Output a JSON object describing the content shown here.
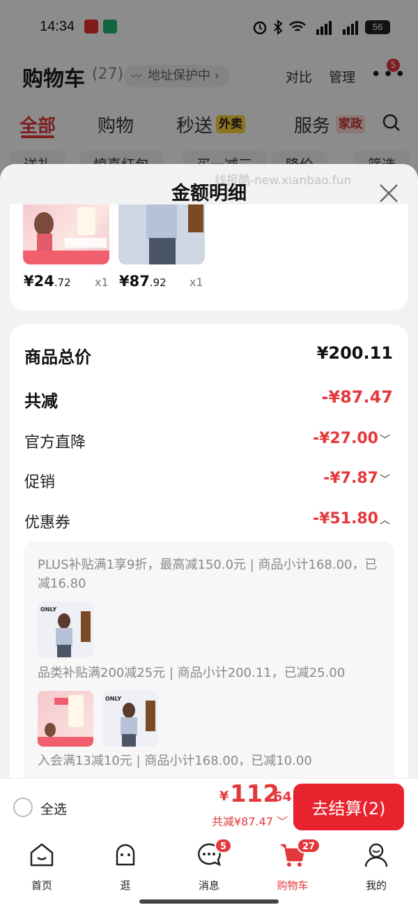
{
  "status_bar": {
    "time": "14:34",
    "battery": "56"
  },
  "header": {
    "title": "购物车",
    "count": "(27)",
    "address_protect": "地址保护中",
    "compare": "对比",
    "manage": "管理",
    "more_badge": "5"
  },
  "tabs": [
    {
      "label": "全部"
    },
    {
      "label": "购物"
    },
    {
      "label": "秒送",
      "pill": "外卖"
    },
    {
      "label": "服务",
      "pill": "家政"
    }
  ],
  "chips": [
    "送礼",
    "惊喜红包",
    "买一减三",
    "降价",
    "筛选"
  ],
  "sheet": {
    "title": "金额明细",
    "watermark": "线报酷-new.xianbao.fun",
    "products": [
      {
        "price_int": "¥24",
        "price_dec": ".72",
        "qty": "x1"
      },
      {
        "price_int": "¥87",
        "price_dec": ".92",
        "qty": "x1"
      }
    ],
    "rows": {
      "total": {
        "label": "商品总价",
        "value": "¥200.11"
      },
      "discount": {
        "label": "共减",
        "value": "-¥87.47"
      },
      "official": {
        "label": "官方直降",
        "value": "-¥27.00"
      },
      "promo": {
        "label": "促销",
        "value": "-¥7.87"
      },
      "coupon": {
        "label": "优惠券",
        "value": "-¥51.80"
      }
    },
    "coupons": [
      "PLUS补贴满1享9折，最高减150.0元 | 商品小计168.00，已减16.80",
      "品类补贴满200减25元 | 商品小计200.11，已减25.00",
      "入会满13减10元 | 商品小计168.00，已减10.00"
    ],
    "thumb_brand": "ONLY"
  },
  "action_bar": {
    "select_all": "全选",
    "total_symbol": "¥",
    "total_int": "112",
    "total_dec": ".64",
    "saved": "共减¥87.47",
    "checkout": "去结算(2)"
  },
  "bottom_nav": [
    {
      "label": "首页"
    },
    {
      "label": "逛"
    },
    {
      "label": "消息",
      "badge": "5"
    },
    {
      "label": "购物车",
      "badge": "27"
    },
    {
      "label": "我的"
    }
  ],
  "colors": {
    "accent": "#e4393c",
    "checkout": "#e8232e",
    "takeout_pill": "#ffd43b"
  }
}
